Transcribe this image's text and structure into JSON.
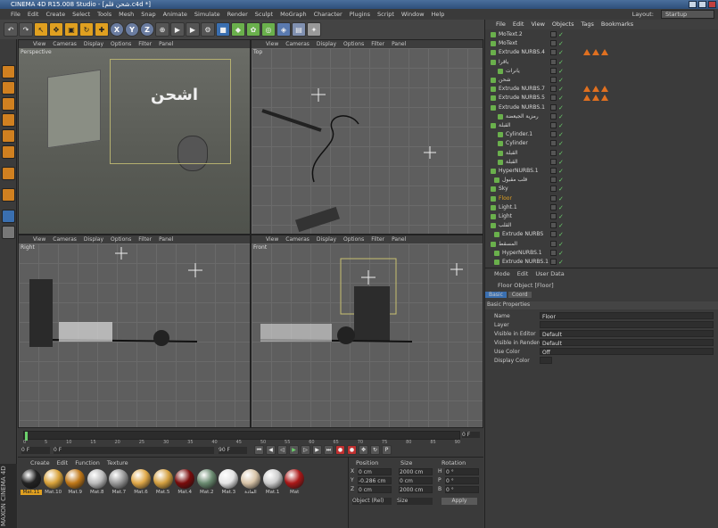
{
  "window": {
    "title": "CINEMA 4D R15.008 Studio - [شحن قلم.c4d *]"
  },
  "menu": [
    "File",
    "Edit",
    "Create",
    "Select",
    "Tools",
    "Mesh",
    "Snap",
    "Animate",
    "Simulate",
    "Render",
    "Sculpt",
    "MoGraph",
    "Character",
    "Plugins",
    "Script",
    "Window",
    "Help"
  ],
  "layout": {
    "label": "Layout:",
    "value": "Startup"
  },
  "viewport_menu": [
    "View",
    "Cameras",
    "Display",
    "Options",
    "Filter",
    "Panel"
  ],
  "viewports": {
    "tl": "Perspective",
    "tr": "Top",
    "bl": "Right",
    "br": "Front"
  },
  "objects": {
    "menu": [
      "File",
      "Edit",
      "View",
      "Objects",
      "Tags",
      "Bookmarks"
    ],
    "rows": [
      {
        "name": "MoText.2",
        "indent": 0
      },
      {
        "name": "MoText",
        "indent": 0
      },
      {
        "name": "Extrude NURBS.4",
        "indent": 0
      },
      {
        "name": "ياقرا",
        "indent": 0
      },
      {
        "name": "يانرات",
        "indent": 2
      },
      {
        "name": "شحن",
        "indent": 0
      },
      {
        "name": "Extrude NURBS.7",
        "indent": 0
      },
      {
        "name": "Extrude NURBS.5",
        "indent": 0
      },
      {
        "name": "Extrude NURBS.1",
        "indent": 0
      },
      {
        "name": "رمزية الجيعضة",
        "indent": 2
      },
      {
        "name": "القبلة",
        "indent": 0
      },
      {
        "name": "Cylinder.1",
        "indent": 2
      },
      {
        "name": "Cylinder",
        "indent": 2
      },
      {
        "name": "القبلة",
        "indent": 2
      },
      {
        "name": "القبلة",
        "indent": 2
      },
      {
        "name": "HyperNURBS.1",
        "indent": 0
      },
      {
        "name": "قلب مقبول",
        "indent": 1
      },
      {
        "name": "Sky",
        "indent": 0
      },
      {
        "name": "Floor",
        "indent": 0
      },
      {
        "name": "Light.1",
        "indent": 0
      },
      {
        "name": "Light",
        "indent": 0
      },
      {
        "name": "القلب",
        "indent": 0
      },
      {
        "name": "Extrude NURBS",
        "indent": 1
      },
      {
        "name": "المسقط",
        "indent": 0
      },
      {
        "name": "HyperNURBS.1",
        "indent": 1
      },
      {
        "name": "Extrude NURBS.1",
        "indent": 1
      }
    ]
  },
  "attributes": {
    "menu": [
      "Mode",
      "Edit",
      "User Data"
    ],
    "header": "Floor Object [Floor]",
    "tabs": [
      "Basic",
      "Coord"
    ],
    "section": "Basic Properties",
    "rows": [
      {
        "label": "Name",
        "value": "Floor"
      },
      {
        "label": "Layer",
        "value": ""
      },
      {
        "label": "Visible in Editor",
        "value": "Default"
      },
      {
        "label": "Visible in Renderer",
        "value": "Default"
      },
      {
        "label": "Use Color",
        "value": "Off"
      },
      {
        "label": "Display Color",
        "value": ""
      }
    ]
  },
  "timeline": {
    "start": "0 F",
    "current": "0 F",
    "end": "90 F",
    "frame": "0 F",
    "ticks": [
      "0",
      "5",
      "10",
      "15",
      "20",
      "25",
      "30",
      "35",
      "40",
      "45",
      "50",
      "55",
      "60",
      "65",
      "70",
      "75",
      "80",
      "85",
      "90"
    ]
  },
  "materials": {
    "menu": [
      "Create",
      "Edit",
      "Function",
      "Texture"
    ],
    "items": [
      {
        "name": "Mat.11",
        "color": "#222222"
      },
      {
        "name": "Mat.10",
        "color": "#d8a23a"
      },
      {
        "name": "Mat.9",
        "color": "#c07818"
      },
      {
        "name": "Mat.8",
        "color": "#bbbbbb"
      },
      {
        "name": "Mat.7",
        "color": "#999999"
      },
      {
        "name": "Mat.6",
        "color": "#e0a848"
      },
      {
        "name": "Mat.5",
        "color": "#d4a040"
      },
      {
        "name": "Mat.4",
        "color": "#7a0c0c"
      },
      {
        "name": "Mat.2",
        "color": "#6a8a70"
      },
      {
        "name": "Mat.3",
        "color": "#e4e4e4"
      },
      {
        "name": "المادة",
        "color": "#d8c4a8"
      },
      {
        "name": "Mat.1",
        "color": "#cccccc"
      },
      {
        "name": "Mat",
        "color": "#aa1818"
      }
    ]
  },
  "coords": {
    "headers": [
      "Position",
      "Size",
      "Rotation"
    ],
    "rows": [
      {
        "axis": "X",
        "pos": "0 cm",
        "size": "2000 cm",
        "rlab": "H",
        "rot": "0 °"
      },
      {
        "axis": "Y",
        "pos": "-0.286 cm",
        "size": "0 cm",
        "rlab": "P",
        "rot": "0 °"
      },
      {
        "axis": "Z",
        "pos": "0 cm",
        "size": "2000 cm",
        "rlab": "B",
        "rot": "0 °"
      }
    ],
    "mode": "Object (Rel)",
    "size_mode": "Size",
    "apply": "Apply"
  },
  "brand": "MAXON CINEMA 4D",
  "colors": {
    "accent": "#e0a020",
    "selection": "#e07020"
  }
}
